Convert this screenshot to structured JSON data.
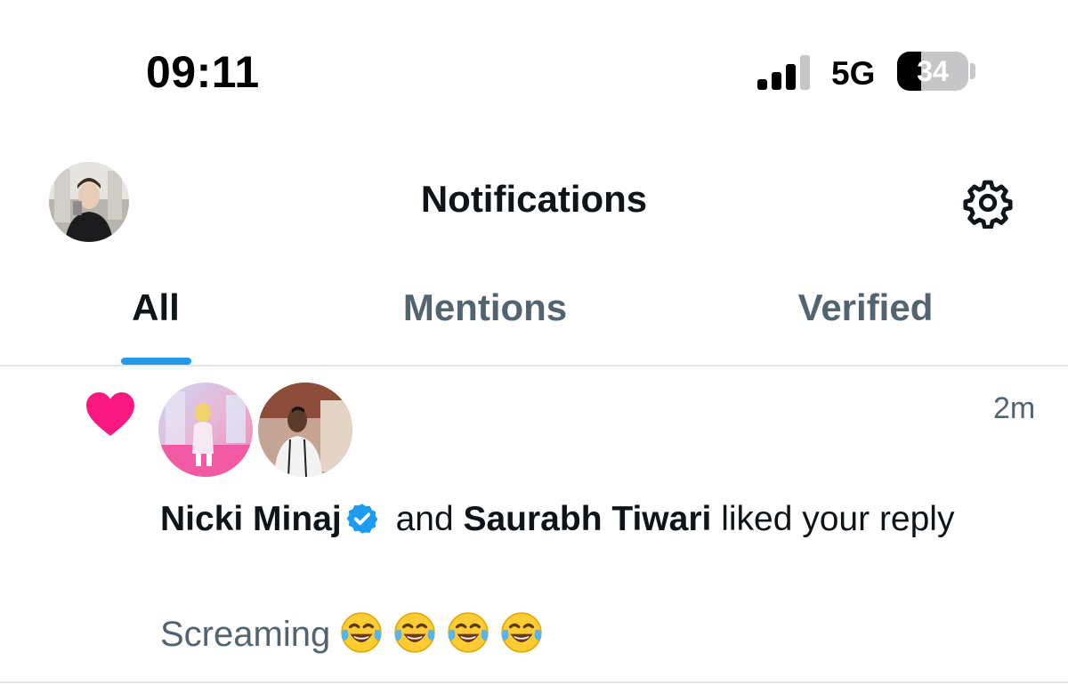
{
  "status_bar": {
    "time": "09:11",
    "network": "5G",
    "battery": 34,
    "battery_label": "34",
    "signal_bars_active": 3
  },
  "header": {
    "title": "Notifications",
    "settings_icon": "gear-icon"
  },
  "tabs": [
    {
      "label": "All",
      "active": true
    },
    {
      "label": "Mentions",
      "active": false
    },
    {
      "label": "Verified",
      "active": false
    }
  ],
  "notification": {
    "icon": "heart-icon",
    "icon_color": "#f91880",
    "time_ago": "2m",
    "user1": "Nicki Minaj",
    "user1_verified": true,
    "connector": " and ",
    "user2": "Saurabh Tiwari",
    "action": " liked your reply",
    "preview_text": "Screaming",
    "preview_emoji": "face-with-tears-of-joy",
    "preview_emoji_count": 4
  },
  "colors": {
    "accent": "#1d9bf0",
    "text_primary": "#0f1419",
    "text_secondary": "#536471",
    "like": "#f91880"
  }
}
